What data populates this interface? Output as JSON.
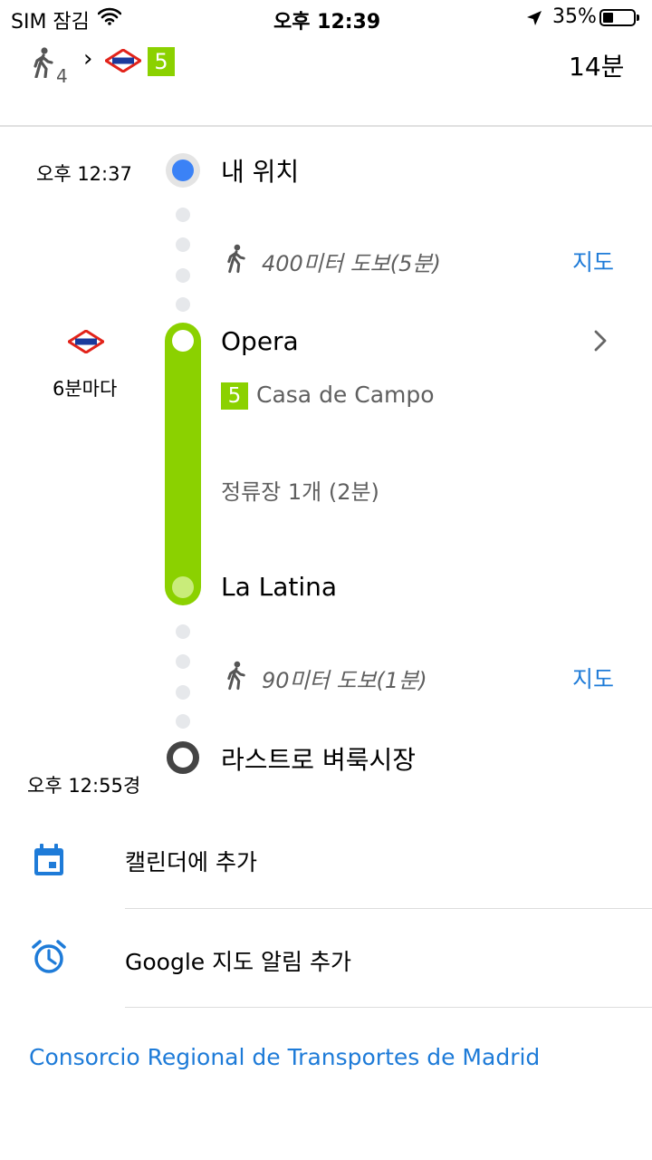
{
  "status_bar": {
    "carrier": "SIM 잠김",
    "time": "오후 12:39",
    "battery": "35%",
    "battery_level": 0.35
  },
  "summary": {
    "walk_subscript": "4",
    "arrow": "›",
    "line_number": "5",
    "duration": "14분"
  },
  "timeline": {
    "start_time": "오후 12:37",
    "start_label": "내 위치",
    "walk1_text": "400미터 도보(5분)",
    "walk1_map": "지도",
    "frequency": "6분마다",
    "board_stop": "Opera",
    "line_badge": "5",
    "direction": "Casa de Campo",
    "stops_info": "정류장 1개 (2분)",
    "alight_stop": "La Latina",
    "walk2_text": "90미터 도보(1분)",
    "walk2_map": "지도",
    "destination": "라스트로 벼룩시장",
    "end_time": "오후 12:55경"
  },
  "actions": [
    {
      "label": "캘린더에 추가",
      "icon": "calendar-icon"
    },
    {
      "label": "Google 지도 알림 추가",
      "icon": "alarm-clock-icon"
    }
  ],
  "credit": "Consorcio Regional de Transportes de Madrid",
  "colors": {
    "line5": "#8bd100",
    "accent_blue": "#1e7bd8",
    "metro_red": "#e2231a",
    "metro_blue": "#1b3a9c",
    "location_blue": "#3b82f6"
  }
}
